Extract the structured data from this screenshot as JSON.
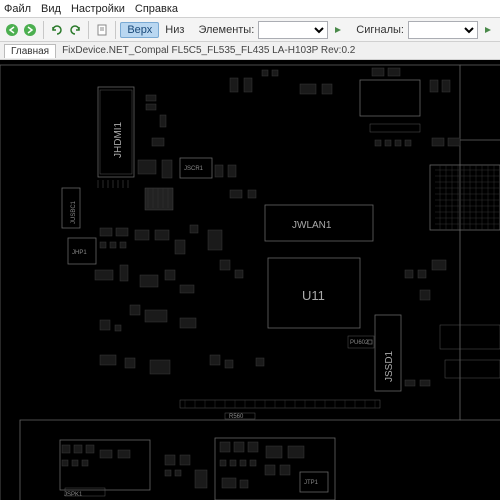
{
  "menu": {
    "file": "Файл",
    "view": "Вид",
    "settings": "Настройки",
    "help": "Справка"
  },
  "toolbar": {
    "verh": "Верх",
    "niz": "Низ",
    "elements": "Элементы:",
    "signals": "Сигналы:"
  },
  "tabs": {
    "main": "Главная",
    "title": "FixDevice.NET_Compal FL5C5_FL535_FL435 LA-H103P Rev:0.2"
  },
  "pcb": {
    "jhdmi1": "JHDMI1",
    "jwlan1": "JWLAN1",
    "u11": "U11",
    "jssd1": "JSSD1",
    "jusbc1": "JUSBC1",
    "jscr1": "JSCR1",
    "jhp1": "JHP1",
    "jtp1": "JTP1",
    "jspk1": "JSPK1",
    "r560": "R560",
    "pu602": "PU602"
  }
}
